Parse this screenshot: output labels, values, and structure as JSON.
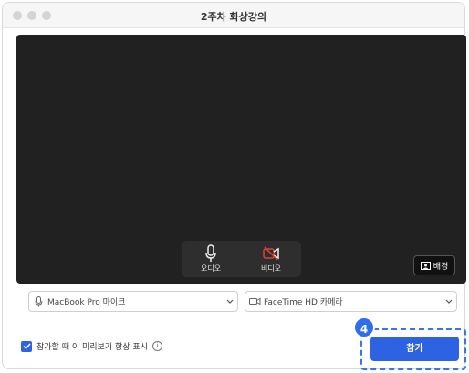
{
  "window": {
    "title": "2주차 화상강의"
  },
  "preview": {
    "audio_label": "오디오",
    "video_label": "비디오",
    "background_label": "배경"
  },
  "devices": {
    "microphone_value": "MacBook Pro 마이크",
    "camera_value": "FaceTime HD 카메라"
  },
  "footer": {
    "preview_checkbox_label": "참가할 때 이 미리보기 항상 표시",
    "preview_checkbox_checked": true,
    "join_label": "참가",
    "step_number": "4"
  },
  "colors": {
    "accent": "#2d63e2",
    "preview_bg": "#212121",
    "muted_video_red": "#e0413a"
  },
  "icons": [
    "microphone-icon",
    "video-camera-muted-icon",
    "background-icon",
    "chevron-down-icon",
    "info-icon",
    "checkmark-icon"
  ]
}
